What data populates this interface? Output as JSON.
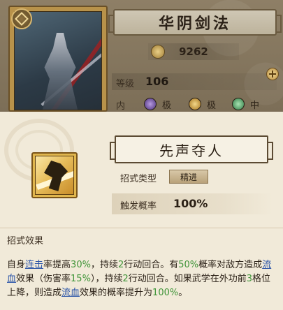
{
  "background": {
    "skill_name": "华阴剑法",
    "power": "9262",
    "level_label": "等级",
    "level_value": "106",
    "neiyuan_label": "内息",
    "neiyuan_items": [
      {
        "text": "极",
        "color": "#6a4b9a"
      },
      {
        "text": "极",
        "color": "#c08f2f"
      },
      {
        "text": "中",
        "color": "#3f9a5a"
      }
    ]
  },
  "detail": {
    "move_name": "先声夺人",
    "type_label": "招式类型",
    "type_value": "精进",
    "trigger_label": "触发概率",
    "trigger_value": "100%",
    "effect_title": "招式效果",
    "description": {
      "p1": "自身",
      "link1": "连击",
      "p2": "率提高",
      "n1": "30%",
      "p3": "，持续",
      "n2": "2",
      "p4": "行动回合。有",
      "n3": "50%",
      "p5": "概率对敌方造成",
      "link2": "流血",
      "p6": "效果（伤害率",
      "n4": "15%",
      "p7": "），持续",
      "n5": "2",
      "p8": "行动回合。如果武学在外功前",
      "n6": "3",
      "p9": "格位上降，则造成",
      "link3": "流血",
      "p10": "效果的概率提升为",
      "n7": "100%",
      "p11": "。"
    }
  }
}
